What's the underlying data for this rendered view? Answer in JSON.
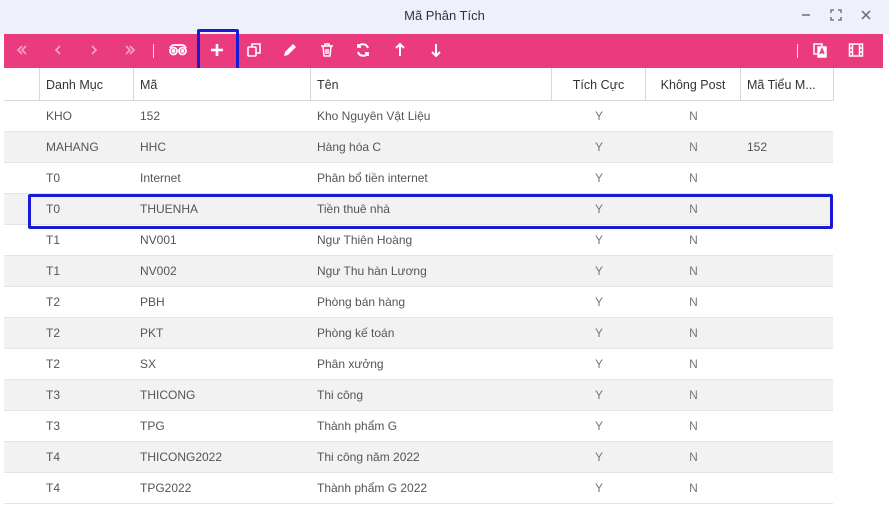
{
  "window": {
    "title": "Mã Phân Tích"
  },
  "toolbar": {
    "buttons": [
      {
        "name": "first-page",
        "icon": "double-chevron-left-icon"
      },
      {
        "name": "prev-page",
        "icon": "chevron-left-icon"
      },
      {
        "name": "next-page",
        "icon": "chevron-right-icon"
      },
      {
        "name": "last-page",
        "icon": "double-chevron-right-icon"
      },
      {
        "name": "view",
        "icon": "binoculars-icon"
      },
      {
        "name": "add",
        "icon": "plus-icon"
      },
      {
        "name": "copy",
        "icon": "copy-icon"
      },
      {
        "name": "edit",
        "icon": "pencil-icon"
      },
      {
        "name": "delete",
        "icon": "trash-icon"
      },
      {
        "name": "refresh",
        "icon": "refresh-icon"
      },
      {
        "name": "move-up",
        "icon": "arrow-up-icon"
      },
      {
        "name": "move-down",
        "icon": "arrow-down-icon"
      },
      {
        "name": "translate",
        "icon": "translate-icon"
      },
      {
        "name": "film",
        "icon": "film-icon"
      }
    ],
    "accent_color": "#ea3b7e",
    "highlight_color": "#1a1ad6"
  },
  "table": {
    "columns": [
      "Danh Mục",
      "Mã",
      "Tên",
      "Tích Cực",
      "Không Post",
      "Mã Tiểu M..."
    ],
    "rows": [
      [
        "KHO",
        "152",
        "Kho Nguyên Vật Liệu",
        "Y",
        "N",
        ""
      ],
      [
        "MAHANG",
        "HHC",
        "Hàng hóa C",
        "Y",
        "N",
        "152"
      ],
      [
        "T0",
        "Internet",
        "Phân bổ tiền internet",
        "Y",
        "N",
        ""
      ],
      [
        "T0",
        "THUENHA",
        "Tiền thuê nhà",
        "Y",
        "N",
        ""
      ],
      [
        "T1",
        "NV001",
        "Ngư Thiên Hoàng",
        "Y",
        "N",
        ""
      ],
      [
        "T1",
        "NV002",
        "Ngư Thu hàn Lương",
        "Y",
        "N",
        ""
      ],
      [
        "T2",
        "PBH",
        "Phòng bán hàng",
        "Y",
        "N",
        ""
      ],
      [
        "T2",
        "PKT",
        "Phòng kế toán",
        "Y",
        "N",
        ""
      ],
      [
        "T2",
        "SX",
        "Phân xưởng",
        "Y",
        "N",
        ""
      ],
      [
        "T3",
        "THICONG",
        "Thi công",
        "Y",
        "N",
        ""
      ],
      [
        "T3",
        "TPG",
        "Thành phẩm G",
        "Y",
        "N",
        ""
      ],
      [
        "T4",
        "THICONG2022",
        "Thi công năm 2022",
        "Y",
        "N",
        ""
      ],
      [
        "T4",
        "TPG2022",
        "Thành phẩm G 2022",
        "Y",
        "N",
        ""
      ]
    ],
    "selected_row": 3
  }
}
